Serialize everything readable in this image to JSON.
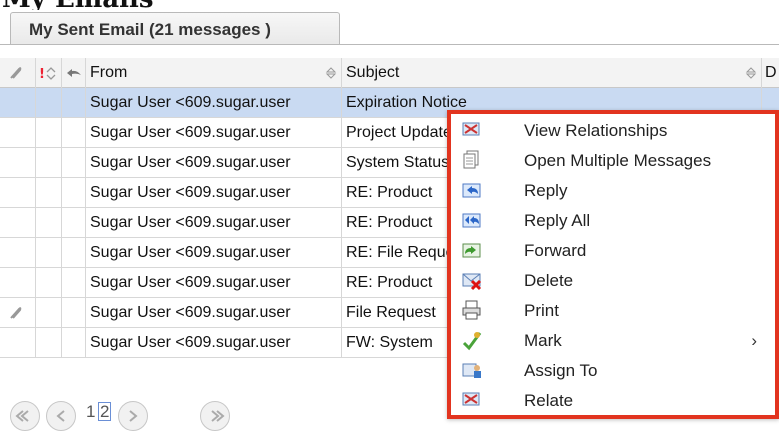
{
  "top_heading_fragment": "My Emails",
  "tab": {
    "label": "My Sent Email (21 messages )"
  },
  "columns": {
    "from": "From",
    "subject": "Subject",
    "date": "D"
  },
  "rows": [
    {
      "from": "Sugar User <609.sugar.user",
      "subject": "Expiration Notice",
      "attachment": false,
      "selected": true
    },
    {
      "from": "Sugar User <609.sugar.user",
      "subject": "Project Update",
      "attachment": false,
      "selected": false
    },
    {
      "from": "Sugar User <609.sugar.user",
      "subject": "System Status",
      "attachment": false,
      "selected": false
    },
    {
      "from": "Sugar User <609.sugar.user",
      "subject": "RE: Product",
      "attachment": false,
      "selected": false
    },
    {
      "from": "Sugar User <609.sugar.user",
      "subject": "RE: Product",
      "attachment": false,
      "selected": false
    },
    {
      "from": "Sugar User <609.sugar.user",
      "subject": "RE: File Request",
      "attachment": false,
      "selected": false
    },
    {
      "from": "Sugar User <609.sugar.user",
      "subject": "RE: Product",
      "attachment": false,
      "selected": false
    },
    {
      "from": "Sugar User <609.sugar.user",
      "subject": "File Request",
      "attachment": true,
      "selected": false
    },
    {
      "from": "Sugar User <609.sugar.user",
      "subject": "FW: System",
      "attachment": false,
      "selected": false
    }
  ],
  "pager": {
    "page1": "1",
    "page2": "2"
  },
  "context_menu": {
    "items": [
      {
        "label": "View Relationships",
        "icon": "view-relationships-icon"
      },
      {
        "label": "Open Multiple Messages",
        "icon": "open-multiple-icon"
      },
      {
        "label": "Reply",
        "icon": "reply-icon"
      },
      {
        "label": "Reply All",
        "icon": "reply-all-icon"
      },
      {
        "label": "Forward",
        "icon": "forward-icon"
      },
      {
        "label": "Delete",
        "icon": "delete-icon"
      },
      {
        "label": "Print",
        "icon": "print-icon"
      },
      {
        "label": "Mark",
        "icon": "mark-icon",
        "submenu_arrow": "›"
      },
      {
        "label": "Assign To",
        "icon": "assign-icon"
      },
      {
        "label": "Relate",
        "icon": "relate-icon"
      }
    ]
  },
  "colors": {
    "selection": "#c9daf2",
    "menu_border": "#e2341f",
    "header_bg": "#f3f3f3"
  }
}
